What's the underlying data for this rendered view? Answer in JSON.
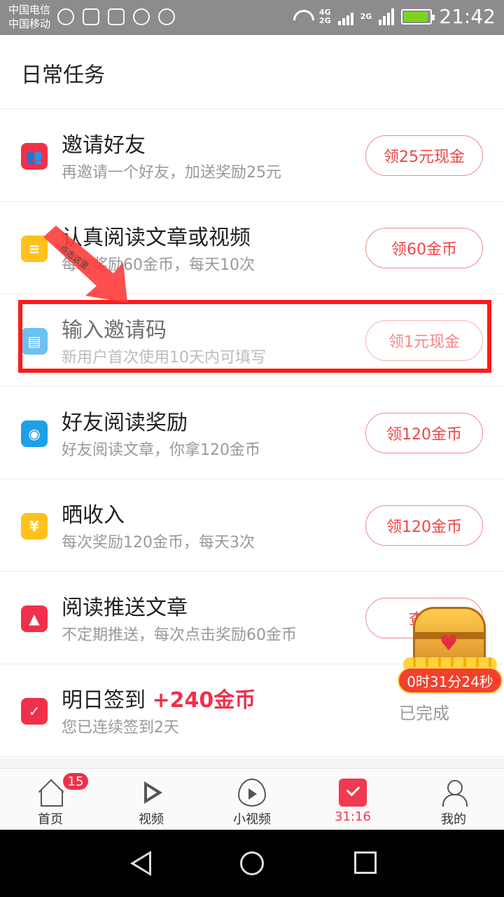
{
  "status_bar": {
    "carrier1": "中国电信",
    "carrier2": "中国移动",
    "net1": "4G",
    "net2": "2G",
    "net3": "2G",
    "time": "21:42"
  },
  "header": {
    "title": "日常任务"
  },
  "tasks": [
    {
      "icon": "invite-friends-icon",
      "color": "#f0304a",
      "title": "邀请好友",
      "sub": "再邀请一个好友，加送奖励25元",
      "button": "领25元现金"
    },
    {
      "icon": "document-icon",
      "color": "#ffc21c",
      "title": "认真阅读文章或视频",
      "sub": "每次奖励60金币，每天10次",
      "button": "领60金币"
    },
    {
      "icon": "ticket-icon",
      "color": "#1ea0e6",
      "title": "输入邀请码",
      "sub": "新用户首次使用10天内可填写",
      "button": "领1元现金"
    },
    {
      "icon": "eye-icon",
      "color": "#1ea0e6",
      "title": "好友阅读奖励",
      "sub": "好友阅读文章，你拿120金币",
      "button": "领120金币"
    },
    {
      "icon": "money-bag-icon",
      "color": "#ffc21c",
      "title": "晒收入",
      "sub": "每次奖励120金币，每天3次",
      "button": "领120金币"
    },
    {
      "icon": "bell-icon",
      "color": "#f0304a",
      "title": "阅读推送文章",
      "sub": "不定期推送，每次点击奖励60金币",
      "button": "查看"
    },
    {
      "icon": "calendar-check-icon",
      "color": "#f0304a",
      "title": "明日签到",
      "bonus": "+240金币",
      "sub": "您已连续签到2天",
      "status": "已完成"
    }
  ],
  "annotation": {
    "arrow_label": "点击这里"
  },
  "chest": {
    "timer": "0时31分24秒"
  },
  "tabbar": {
    "items": [
      {
        "label": "首页",
        "badge": "15"
      },
      {
        "label": "视频"
      },
      {
        "label": "小视频"
      },
      {
        "label": "31:16"
      },
      {
        "label": "我的"
      }
    ]
  },
  "colors": {
    "accent": "#f0304a",
    "highlight": "#ff1b1b"
  }
}
